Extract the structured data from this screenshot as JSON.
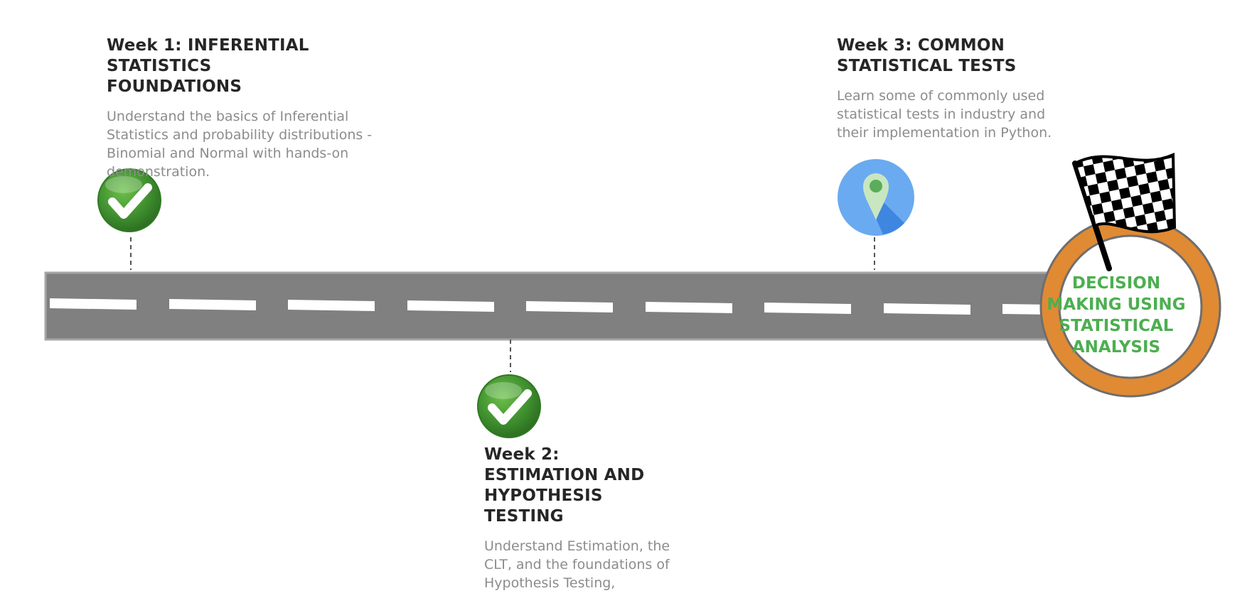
{
  "milestones": [
    {
      "title": "Week 1: INFERENTIAL STATISTICS FOUNDATIONS",
      "description": "Understand the basics of Inferential Statistics and probability distributions - Binomial and Normal with hands-on demonstration.",
      "status_icon": "check-icon"
    },
    {
      "title": "Week 2: ESTIMATION AND HYPOTHESIS TESTING",
      "description": "Understand Estimation, the CLT, and the foundations of Hypothesis Testing,",
      "status_icon": "check-icon"
    },
    {
      "title": "Week 3: COMMON STATISTICAL TESTS",
      "description": "Learn some of commonly used statistical tests in industry and their implementation in Python.",
      "status_icon": "location-pin-icon"
    }
  ],
  "goal": {
    "label": "DECISION MAKING USING STATISTICAL ANALYSIS",
    "icon": "checkered-flag-icon"
  },
  "colors": {
    "road": "#808080",
    "road_dash": "#ffffff",
    "check_green": "#3f8f2f",
    "pin_blue": "#6aaaf0",
    "goal_ring": "#e08a33",
    "goal_text": "#4caf50"
  }
}
